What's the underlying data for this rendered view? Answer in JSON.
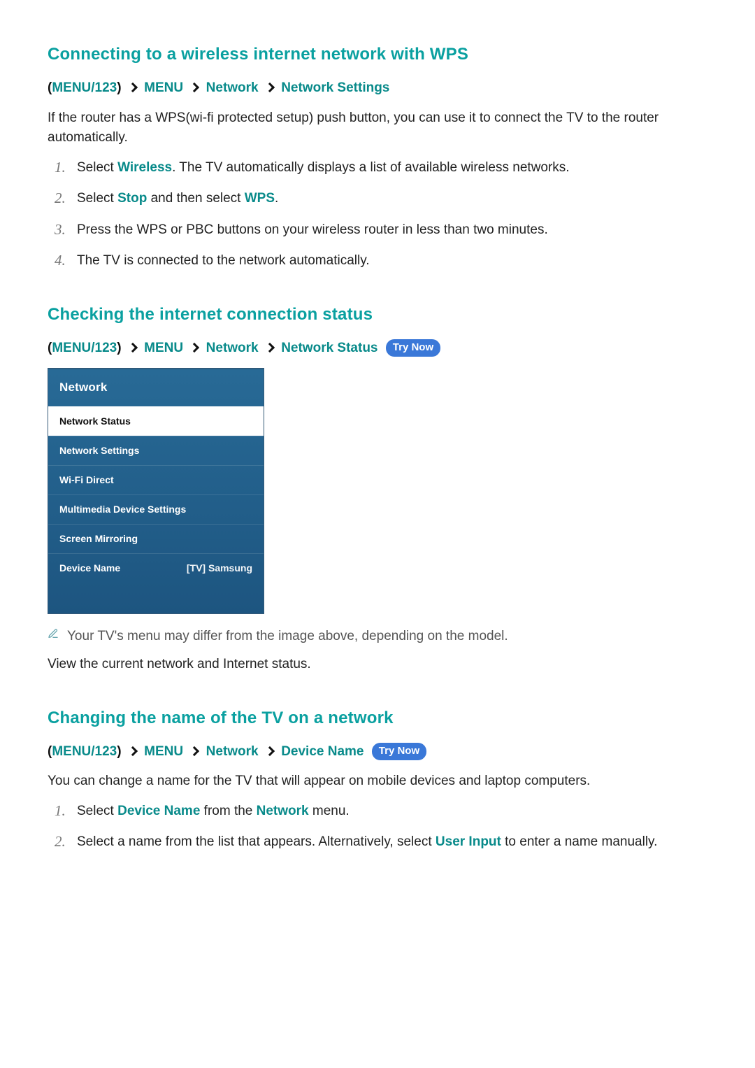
{
  "sections": {
    "wps": {
      "heading": "Connecting to a wireless internet network with WPS",
      "path": {
        "root": "MENU/123",
        "items": [
          "MENU",
          "Network",
          "Network Settings"
        ]
      },
      "intro": "If the router has a WPS(wi-fi protected setup) push button, you can use it to connect the TV to the router automatically.",
      "steps": {
        "s1": {
          "pre": "Select ",
          "kw": "Wireless",
          "post": ". The TV automatically displays a list of available wireless networks."
        },
        "s2": {
          "pre": "Select ",
          "kw1": "Stop",
          "mid": " and then select ",
          "kw2": "WPS",
          "post": "."
        },
        "s3": "Press the WPS or PBC buttons on your wireless router in less than two minutes.",
        "s4": "The TV is connected to the network automatically."
      }
    },
    "status": {
      "heading": "Checking the internet connection status",
      "path": {
        "root": "MENU/123",
        "items": [
          "MENU",
          "Network",
          "Network Status"
        ]
      },
      "try_now": "Try Now",
      "panel": {
        "title": "Network",
        "items": [
          {
            "label": "Network Status",
            "highlight": true
          },
          {
            "label": "Network Settings"
          },
          {
            "label": "Wi-Fi Direct"
          },
          {
            "label": "Multimedia Device Settings"
          },
          {
            "label": "Screen Mirroring"
          },
          {
            "label": "Device Name",
            "value": "[TV] Samsung"
          }
        ]
      },
      "note": "Your TV's menu may differ from the image above, depending on the model.",
      "body": "View the current network and Internet status."
    },
    "rename": {
      "heading": "Changing the name of the TV on a network",
      "path": {
        "root": "MENU/123",
        "items": [
          "MENU",
          "Network",
          "Device Name"
        ]
      },
      "try_now": "Try Now",
      "intro": "You can change a name for the TV that will appear on mobile devices and laptop computers.",
      "steps": {
        "s1": {
          "pre": "Select ",
          "kw1": "Device Name",
          "mid": " from the ",
          "kw2": "Network",
          "post": " menu."
        },
        "s2": {
          "pre": "Select a name from the list that appears. Alternatively, select ",
          "kw": "User Input",
          "post": " to enter a name manually."
        }
      }
    }
  }
}
